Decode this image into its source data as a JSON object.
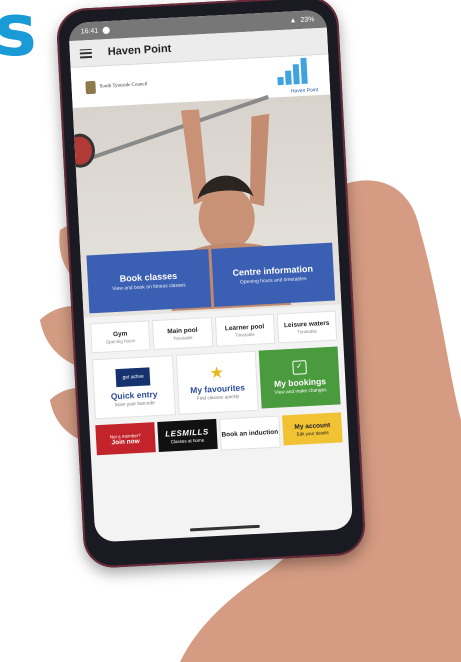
{
  "page_letter": "s",
  "colors": {
    "brand_blue": "#3b5fb3",
    "green": "#4a9b3e",
    "red": "#c3232a",
    "yellow": "#f1c232"
  },
  "status_bar": {
    "time": "16:41",
    "battery": "23%"
  },
  "app": {
    "title": "Haven Point",
    "menu_icon": "hamburger-icon"
  },
  "logos": {
    "council": "South Tyneside Council",
    "haven_point": "Haven Point"
  },
  "cta": [
    {
      "title": "Book classes",
      "subtitle": "View and book on fitness classes"
    },
    {
      "title": "Centre information",
      "subtitle": "Opening hours and timetables"
    }
  ],
  "pools": [
    {
      "title": "Gym",
      "subtitle": "Opening hours"
    },
    {
      "title": "Main pool",
      "subtitle": "Timetable"
    },
    {
      "title": "Learner pool",
      "subtitle": "Timetable"
    },
    {
      "title": "Leisure waters",
      "subtitle": "Timetable"
    }
  ],
  "tiles": [
    {
      "title": "Quick entry",
      "subtitle": "Scan your barcode",
      "badge": "get active"
    },
    {
      "title": "My favourites",
      "subtitle": "Find classes quickly"
    },
    {
      "title": "My bookings",
      "subtitle": "View and make changes"
    }
  ],
  "bottom": [
    {
      "title": "Join now",
      "subtitle": "Not a member?"
    },
    {
      "title": "LESMILLS",
      "subtitle": "Classes at home"
    },
    {
      "title": "Book an induction",
      "subtitle": ""
    },
    {
      "title": "My account",
      "subtitle": "Edit your details"
    }
  ]
}
